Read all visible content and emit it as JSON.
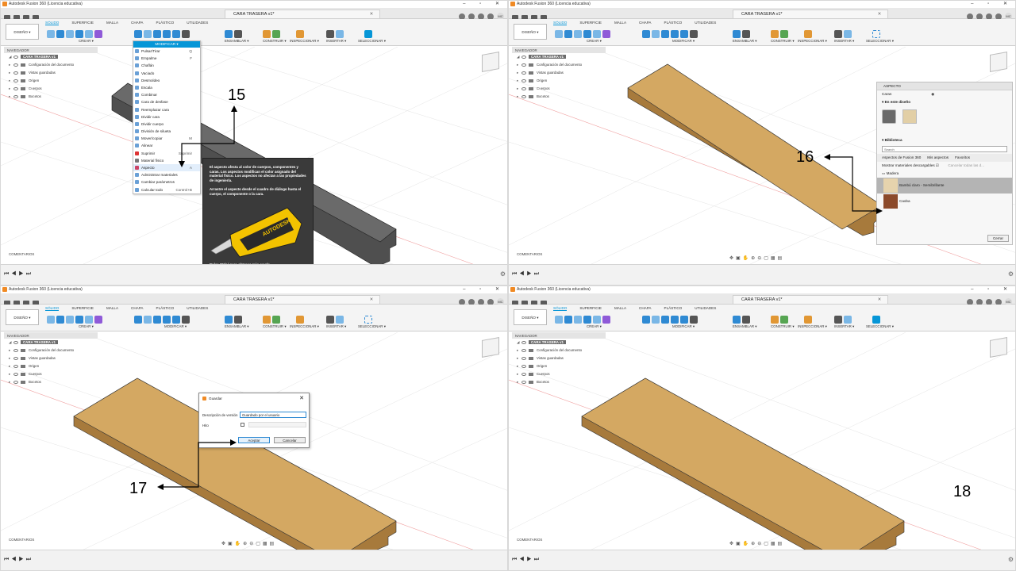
{
  "steps": [
    "15",
    "16",
    "17",
    "18"
  ],
  "panels": [
    {
      "app_title": "Autodesk Fusion 360 (Licencia educativa)",
      "doc_tab": "CARA TRASERA v1*"
    },
    {
      "app_title": "Autodesk Fusion 360 (Licencia educativa)",
      "doc_tab": "CARA TRASERA v1*"
    },
    {
      "app_title": "Autodesk Fusion 360 (Licencia educativa)",
      "doc_tab": "CARA TRASERA v1*"
    },
    {
      "app_title": "Autodesk Fusion 360 (Licencia educativa)",
      "doc_tab": "CARA TRASERA v1*"
    }
  ],
  "user_initials": "MC",
  "toolbar": {
    "design": "DISEÑO ▾",
    "tabs": [
      "SÓLIDO",
      "SUPERFICIE",
      "MALLA",
      "CHAPA",
      "PLÁSTICO",
      "UTILIDADES"
    ],
    "groups": [
      "CREAR ▾",
      "MODIFICAR ▾",
      "ENSAMBLAR ▾",
      "CONSTRUIR ▾",
      "INSPECCIONAR ▾",
      "INSERTAR ▾",
      "SELECCIONAR ▾"
    ]
  },
  "navigator": {
    "header": "NAVEGADOR",
    "root": "CARA TRASERA v1",
    "items": [
      "Configuración del documento",
      "Vistas guardadas",
      "Origen",
      "Cuerpos",
      "Bocetos"
    ]
  },
  "comments_label": "COMENTARIOS",
  "modify_menu": {
    "header": "MODIFICAR ▾",
    "items": [
      {
        "label": "Pulsar/Tirar",
        "shortcut": "Q"
      },
      {
        "label": "Empalme",
        "shortcut": "F"
      },
      {
        "label": "Chaflán",
        "shortcut": ""
      },
      {
        "label": "Vaciado",
        "shortcut": ""
      },
      {
        "label": "Desmoldeo",
        "shortcut": ""
      },
      {
        "label": "Escala",
        "shortcut": ""
      },
      {
        "label": "Combinar",
        "shortcut": ""
      },
      {
        "label": "Cara de desfase",
        "shortcut": ""
      },
      {
        "label": "Reemplazar cara",
        "shortcut": ""
      },
      {
        "label": "Dividir cara",
        "shortcut": ""
      },
      {
        "label": "Dividir cuerpo",
        "shortcut": ""
      },
      {
        "label": "División de silueta",
        "shortcut": ""
      },
      {
        "label": "Mover/copiar",
        "shortcut": "M"
      },
      {
        "label": "Alinear",
        "shortcut": ""
      },
      {
        "label": "Suprimir",
        "shortcut": "Suprimir"
      },
      {
        "label": "Material físico",
        "shortcut": ""
      },
      {
        "label": "Aspecto",
        "shortcut": "A"
      },
      {
        "label": "Administrar materiales",
        "shortcut": ""
      },
      {
        "label": "Cambiar parámetros",
        "shortcut": ""
      },
      {
        "label": "Calcular todo",
        "shortcut": "Control+B"
      }
    ]
  },
  "tooltip": {
    "text1": "El aspecto afecta al color de cuerpos, componentes y caras. Los aspectos modifican el color asignado del material físico. Los aspectos no afectan a las propiedades de ingeniería.",
    "text2": "Arrastre el aspecto desde el cuadro de diálogo hasta el cuerpo, el componente o la cara.",
    "hint": "Pulse Ctrl+/ para obtener más ayuda.",
    "brand": "AUTODESK"
  },
  "appearance_panel": {
    "title": "ASPECTO",
    "apply_to": "Caras",
    "in_design": "En este diseño",
    "library": "Biblioteca",
    "search_placeholder": "Search",
    "lib_tabs": [
      "Aspectos de Fusion 360",
      "Mis aspectos",
      "Favoritos"
    ],
    "show_downloadable": "Mostrar materiales descargables",
    "cancel_all": "Cancelar todas las d...",
    "folder": "Madera",
    "items": [
      "Bambú claro - Semibrillante",
      "Caoba"
    ],
    "close": "Cerrar"
  },
  "save_dialog": {
    "title": "Guardar",
    "version_label": "Descripción de versión",
    "version_value": "Guardado por el usuario",
    "milestone_label": "Hito",
    "ok": "Aceptar",
    "cancel": "Cancelar"
  },
  "colors": {
    "accent": "#0696d7",
    "wood": "#d4a862",
    "wood_dark": "#a77a3c",
    "body_gray": "#5f5f5f"
  }
}
